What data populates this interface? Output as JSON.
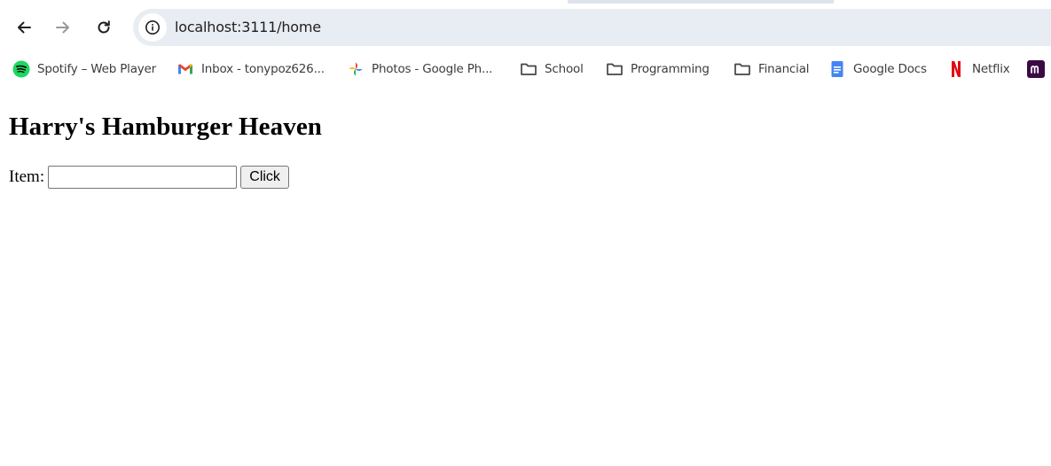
{
  "browser": {
    "url": "localhost:3111/home",
    "bookmarks": [
      {
        "label": "Spotify – Web Player",
        "icon": "spotify-icon"
      },
      {
        "label": "Inbox - tonypoz626...",
        "icon": "gmail-icon"
      },
      {
        "label": "Photos - Google Ph...",
        "icon": "google-photos-icon"
      },
      {
        "label": "School",
        "icon": "folder-icon"
      },
      {
        "label": "Programming",
        "icon": "folder-icon"
      },
      {
        "label": "Financial",
        "icon": "folder-icon"
      },
      {
        "label": "Google Docs",
        "icon": "google-docs-icon"
      },
      {
        "label": "Netflix",
        "icon": "netflix-icon"
      },
      {
        "label": "",
        "icon": "m-app-icon"
      }
    ]
  },
  "page": {
    "title": "Harry's Hamburger Heaven",
    "form": {
      "item_label": "Item:",
      "item_value": "",
      "button_label": "Click"
    }
  },
  "colors": {
    "omnibox": "#e8ecf3",
    "spotify": "#1ed760",
    "netflix": "#e50914",
    "docs": "#4285f4",
    "m_app": "#3b0a45"
  }
}
